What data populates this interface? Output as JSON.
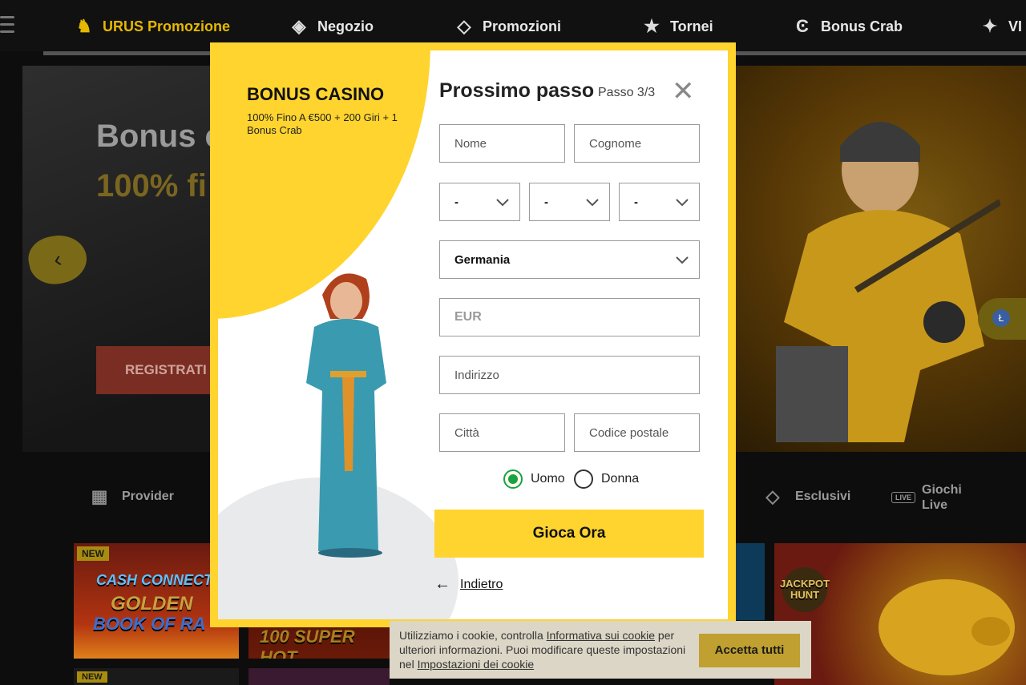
{
  "nav": {
    "items": [
      {
        "label": "URUS Promozione",
        "icon": "lamborghini-icon"
      },
      {
        "label": "Negozio",
        "icon": "ticket-icon"
      },
      {
        "label": "Promozioni",
        "icon": "diamond-icon"
      },
      {
        "label": "Tornei",
        "icon": "star-trophy-icon"
      },
      {
        "label": "Bonus Crab",
        "icon": "crab-c-icon"
      },
      {
        "label": "VI",
        "icon": "stars-icon"
      }
    ]
  },
  "hero": {
    "title": "Bonus c",
    "subtitle": "100% fi",
    "register_label": "REGISTRATI"
  },
  "categories": {
    "provider": "Provider",
    "exclusive": "Esclusivi",
    "live_1": "Giochi",
    "live_2": "Live",
    "live_tag": "LIVE"
  },
  "games": {
    "new_badge": "NEW",
    "cash_connection": "CASH CONNECTION",
    "golden": "GOLDEN",
    "book_of_ra": "BOOK OF RA",
    "super_hot": "100 SUPER HOT",
    "jackpot_hunt": "JACKPOT HUNT"
  },
  "modal": {
    "bonus_title": "BONUS CASINO",
    "bonus_desc": "100% Fino A €500 + 200 Giri + 1 Bonus Crab",
    "form_title": "Prossimo passo",
    "step": "Passo  3/3",
    "fields": {
      "first_name": "Nome",
      "last_name": "Cognome",
      "day": "-",
      "month": "-",
      "year": "-",
      "country": "Germania",
      "currency": "EUR",
      "address": "Indirizzo",
      "city": "Città",
      "postal_code": "Codice postale"
    },
    "gender": {
      "male": "Uomo",
      "female": "Donna",
      "selected": "male"
    },
    "cta": "Gioca Ora",
    "back": "Indietro"
  },
  "cookie": {
    "text_1": "Utilizziamo i cookie, controlla ",
    "link_1": "Informativa sui cookie",
    "text_2": " per ulteriori informazioni. Puoi modificare queste impostazioni nel ",
    "link_2": "Impostazioni dei cookie",
    "accept": "Accetta tutti"
  },
  "colors": {
    "brand_yellow": "#ffd42e",
    "radio_green": "#1aa33a",
    "register_red": "#7a2d22"
  }
}
